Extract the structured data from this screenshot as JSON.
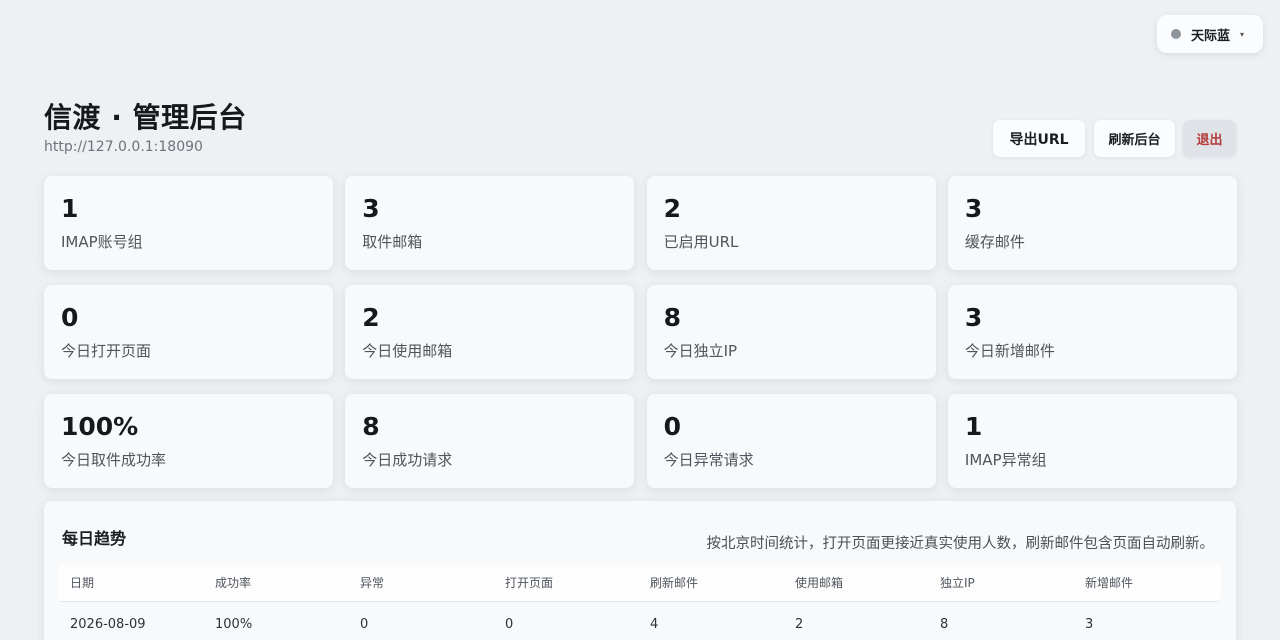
{
  "theme": {
    "label": "天际蓝",
    "caret": "▾",
    "dot_color": "#8e949c"
  },
  "header": {
    "title": "信渡 · 管理后台",
    "url": "http://127.0.0.1:18090",
    "export_label": "导出URL",
    "refresh_label": "刷新后台",
    "logout_label": "退出"
  },
  "stats": [
    {
      "value": "1",
      "label": "IMAP账号组"
    },
    {
      "value": "3",
      "label": "取件邮箱"
    },
    {
      "value": "2",
      "label": "已启用URL"
    },
    {
      "value": "3",
      "label": "缓存邮件"
    },
    {
      "value": "0",
      "label": "今日打开页面"
    },
    {
      "value": "2",
      "label": "今日使用邮箱"
    },
    {
      "value": "8",
      "label": "今日独立IP"
    },
    {
      "value": "3",
      "label": "今日新增邮件"
    },
    {
      "value": "100%",
      "label": "今日取件成功率"
    },
    {
      "value": "8",
      "label": "今日成功请求"
    },
    {
      "value": "0",
      "label": "今日异常请求"
    },
    {
      "value": "1",
      "label": "IMAP异常组"
    }
  ],
  "trend": {
    "title": "每日趋势",
    "note": "按北京时间统计，打开页面更接近真实使用人数，刷新邮件包含页面自动刷新。",
    "columns": [
      "日期",
      "成功率",
      "异常",
      "打开页面",
      "刷新邮件",
      "使用邮箱",
      "独立IP",
      "新增邮件"
    ],
    "rows": [
      [
        "2026-08-09",
        "100%",
        "0",
        "0",
        "4",
        "2",
        "8",
        "3"
      ]
    ]
  }
}
